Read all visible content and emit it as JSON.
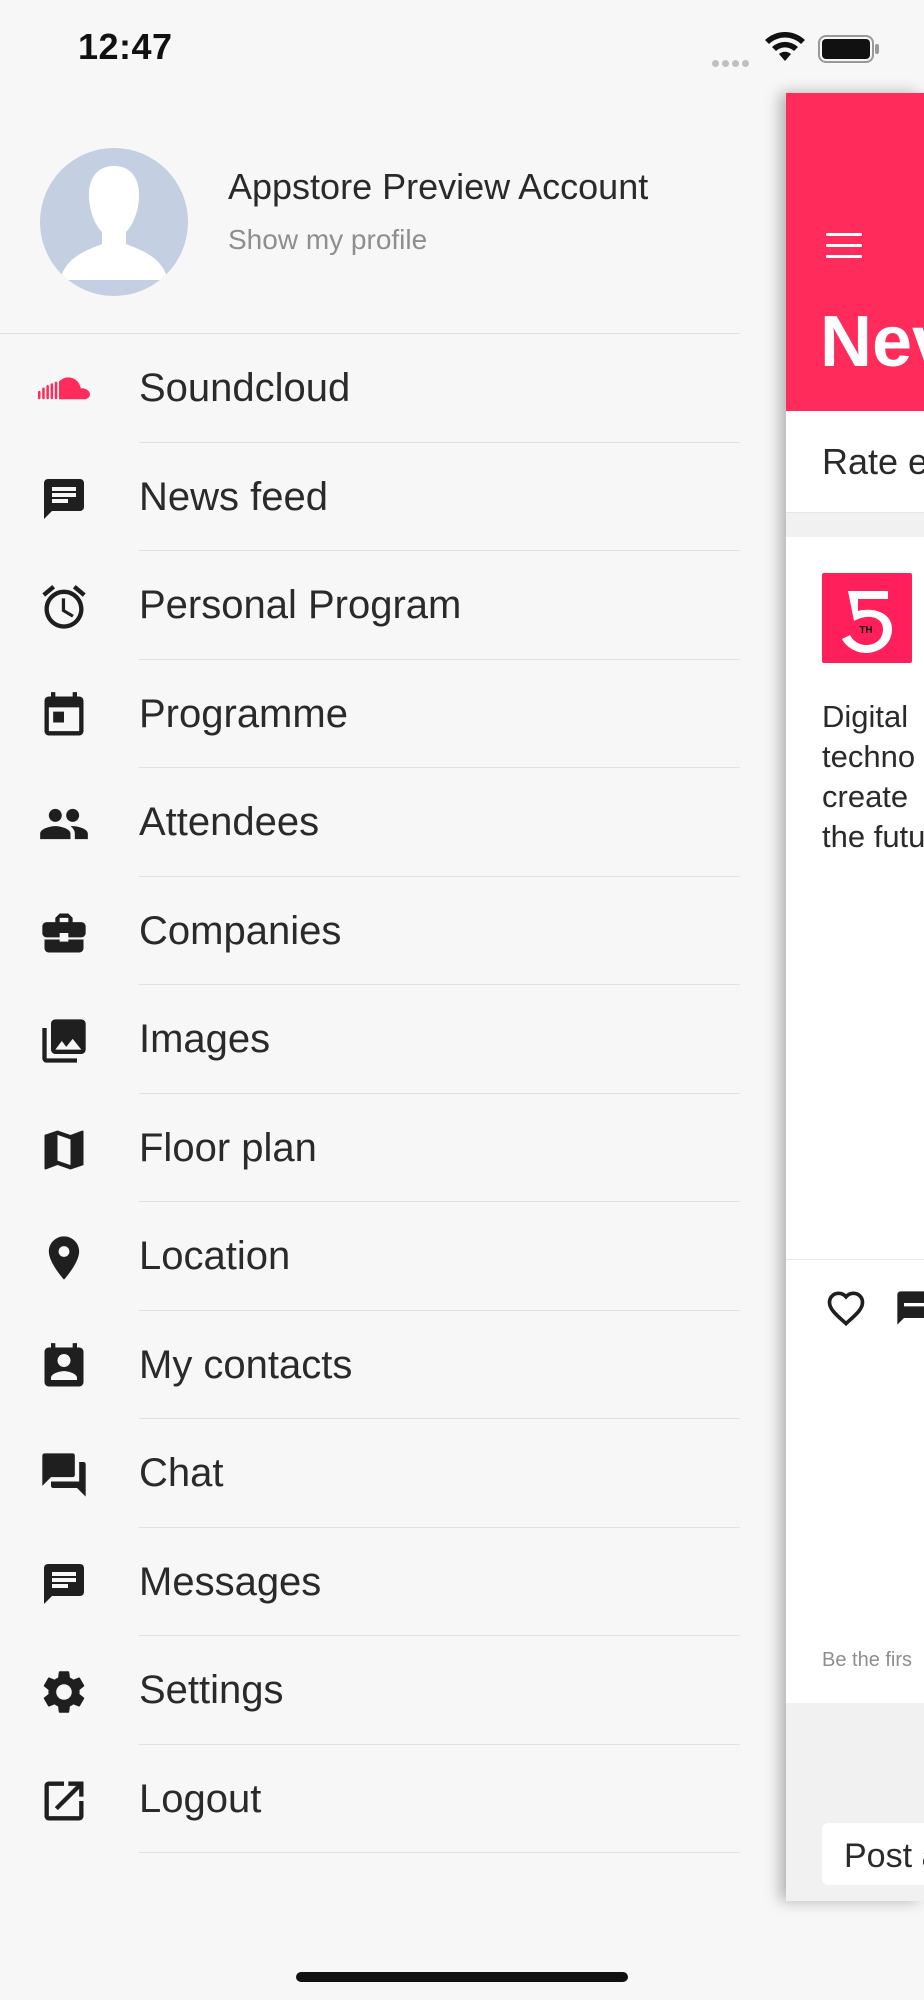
{
  "status_bar": {
    "time": "12:47"
  },
  "profile": {
    "name": "Appstore Preview Account",
    "subtitle": "Show my profile"
  },
  "menu": {
    "items": [
      {
        "label": "Soundcloud",
        "icon": "soundcloud-icon"
      },
      {
        "label": "News feed",
        "icon": "message-icon"
      },
      {
        "label": "Personal Program",
        "icon": "alarm-clock-icon"
      },
      {
        "label": "Programme",
        "icon": "calendar-icon"
      },
      {
        "label": "Attendees",
        "icon": "people-icon"
      },
      {
        "label": "Companies",
        "icon": "briefcase-icon"
      },
      {
        "label": "Images",
        "icon": "photo-library-icon"
      },
      {
        "label": "Floor plan",
        "icon": "map-icon"
      },
      {
        "label": "Location",
        "icon": "location-pin-icon"
      },
      {
        "label": "My contacts",
        "icon": "contact-card-icon"
      },
      {
        "label": "Chat",
        "icon": "chat-bubbles-icon"
      },
      {
        "label": "Messages",
        "icon": "message-icon"
      },
      {
        "label": "Settings",
        "icon": "gear-icon"
      },
      {
        "label": "Logout",
        "icon": "external-link-icon"
      }
    ]
  },
  "main": {
    "title": "Nev",
    "rate_text": "Rate e",
    "post": {
      "text_lines": [
        "Digital",
        "techno",
        "create",
        "the futu"
      ],
      "meta": "Be the firs",
      "logo_text": "TH"
    },
    "post_button": "Post a"
  },
  "colors": {
    "accent": "#ff2b5a",
    "soundcloud": "#ff2b5a",
    "icon": "#1f1f1f",
    "background": "#f7f7f7"
  }
}
